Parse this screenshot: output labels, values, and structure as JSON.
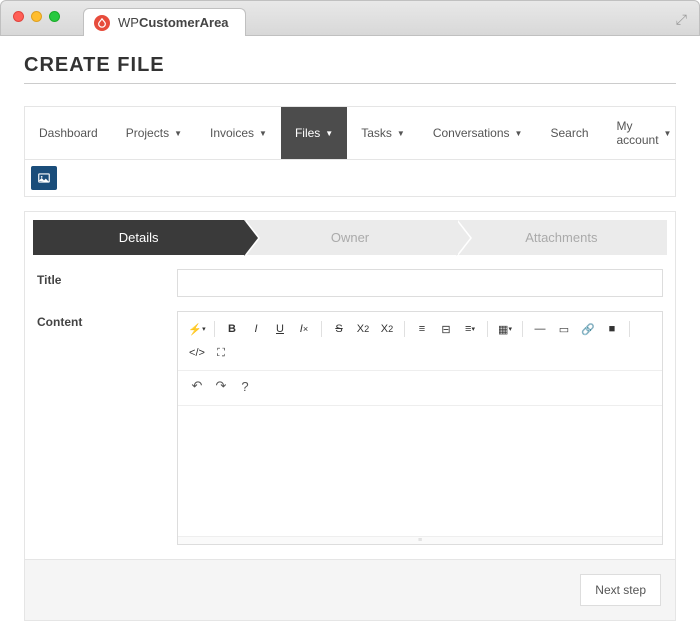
{
  "chrome": {
    "brand_wp": "WP",
    "brand_rest": "CustomerArea"
  },
  "page": {
    "title": "CREATE FILE"
  },
  "nav": {
    "items": [
      {
        "label": "Dashboard",
        "dropdown": false
      },
      {
        "label": "Projects",
        "dropdown": true
      },
      {
        "label": "Invoices",
        "dropdown": true
      },
      {
        "label": "Files",
        "dropdown": true,
        "active": true
      },
      {
        "label": "Tasks",
        "dropdown": true
      },
      {
        "label": "Conversations",
        "dropdown": true
      },
      {
        "label": "Search",
        "dropdown": false
      },
      {
        "label": "My account",
        "dropdown": true
      }
    ]
  },
  "wizard": {
    "steps": [
      {
        "label": "Details",
        "active": true
      },
      {
        "label": "Owner"
      },
      {
        "label": "Attachments"
      }
    ]
  },
  "form": {
    "title_label": "Title",
    "title_value": "",
    "content_label": "Content"
  },
  "footer": {
    "next_label": "Next step"
  }
}
